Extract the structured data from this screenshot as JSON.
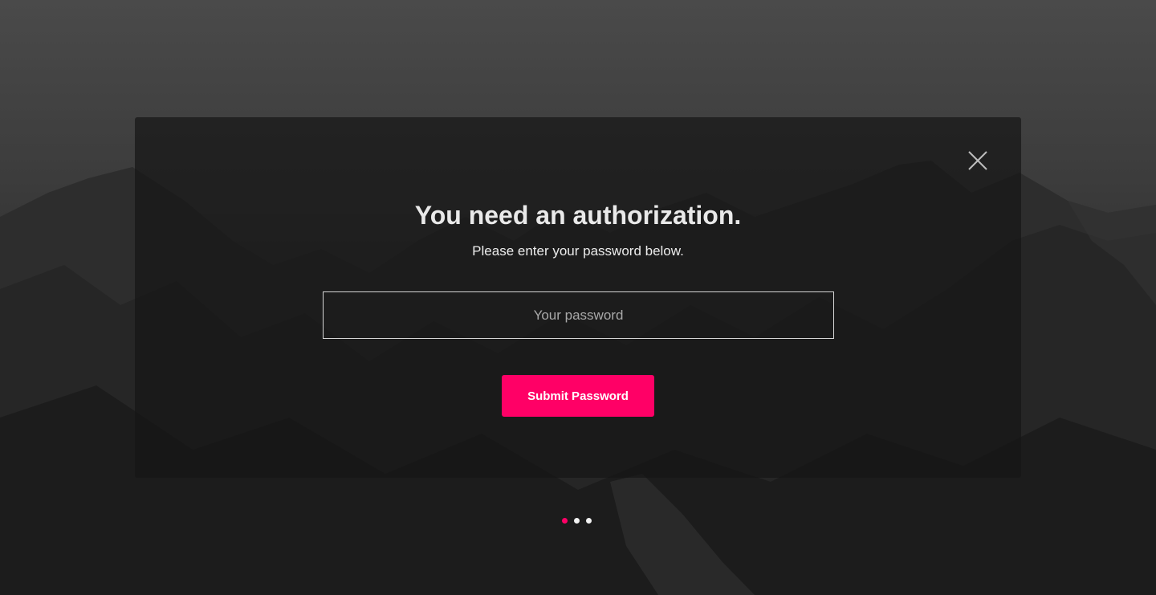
{
  "modal": {
    "title": "You need an authorization.",
    "subtitle": "Please enter your password below.",
    "password_placeholder": "Your password",
    "submit_label": "Submit Password",
    "close_icon": "close-icon"
  },
  "pagination": {
    "count": 3,
    "active_index": 0
  },
  "colors": {
    "accent": "#ff0066",
    "overlay": "#161616"
  },
  "background": {
    "image": "mountain-landscape"
  }
}
